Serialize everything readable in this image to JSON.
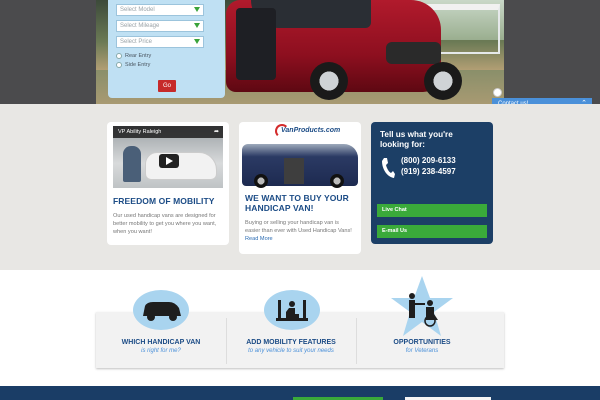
{
  "search": {
    "model_placeholder": "Select Model",
    "mileage_placeholder": "Select Mileage",
    "price_placeholder": "Select Price",
    "rear_entry_label": "Rear Entry",
    "side_entry_label": "Side Entry",
    "go_label": "Go"
  },
  "contact_tab": {
    "label": "Contact us!"
  },
  "video_card": {
    "video_title": "VP Ability Raleigh",
    "title": "FREEDOM OF MOBILITY",
    "text": "Our used handicap vans are designed for better mobility to get you where you want, when you want!"
  },
  "buy_card": {
    "logo_text": "VanProducts.com",
    "title_line1": "WE WANT TO BUY YOUR",
    "title_line2": "HANDICAP VAN!",
    "text": "Buying or selling your handicap van is easier than ever with Used Handicap Vans!",
    "more_label": "Read More"
  },
  "contact_card": {
    "title_line1": "Tell us what you're",
    "title_line2": "looking for:",
    "phone1": "(800) 209-6133",
    "phone2": "(919) 238-4597",
    "live_chat_label": "Live Chat",
    "email_label": "E-mail Us"
  },
  "features": [
    {
      "title": "WHICH HANDICAP VAN",
      "subtitle": "is right for me?",
      "icon": "van-icon"
    },
    {
      "title": "ADD MOBILITY FEATURES",
      "subtitle": "to any vehicle to suit your needs",
      "icon": "wheelchair-lift-icon"
    },
    {
      "title": "OPPORTUNITIES",
      "subtitle": "for Veterans",
      "icon": "veterans-star-icon"
    }
  ],
  "colors": {
    "brand_blue": "#1c4c86",
    "dark_navy": "#1c3f66",
    "accent_green": "#3aaa3a",
    "accent_red": "#c62a2a",
    "light_blue": "#a9d4ef"
  }
}
